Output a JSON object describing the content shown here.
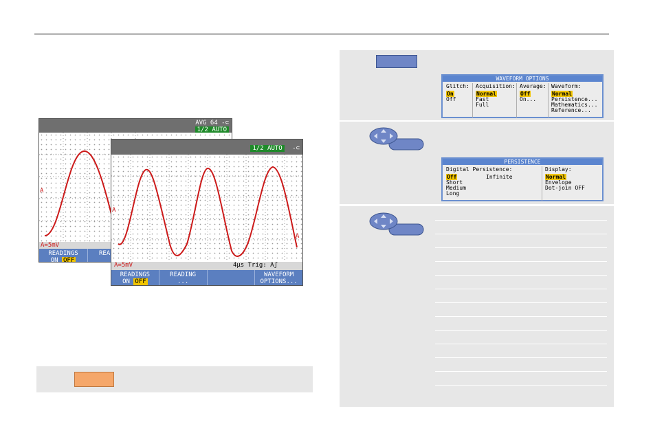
{
  "scope_back": {
    "status": "AVG 64",
    "auto_badge": "1/2 AUTO",
    "trace_label": "A",
    "scale_text": "A=5mV",
    "softkeys": [
      {
        "line1": "READINGS",
        "line2_prefix": "ON",
        "off": "OFF"
      },
      {
        "line1": "REA",
        "line2": ""
      }
    ]
  },
  "scope_front": {
    "auto_badge": "1/2 AUTO",
    "trace_label": "A",
    "end_label": "A",
    "scale_text": "A=5mV",
    "trig_text": "4µs Trig: Aʃ",
    "softkeys": [
      {
        "line1": "READINGS",
        "line2_prefix": "ON",
        "off": "OFF"
      },
      {
        "line1": "READING",
        "line2": "..."
      },
      {
        "line1": "",
        "line2": ""
      },
      {
        "line1": "WAVEFORM",
        "line2": "OPTIONS..."
      }
    ]
  },
  "waveform_options": {
    "title": "WAVEFORM OPTIONS",
    "glitch": {
      "header": "Glitch:",
      "selected": "On",
      "items": [
        "Off"
      ]
    },
    "acquisition": {
      "header": "Acquisition:",
      "selected": "Normal",
      "items": [
        "Fast",
        "Full"
      ]
    },
    "average": {
      "header": "Average:",
      "selected": "Off",
      "items": [
        "On..."
      ]
    },
    "waveform": {
      "header": "Waveform:",
      "selected": "Normal",
      "items": [
        "Persistence...",
        "Mathematics...",
        "Reference..."
      ]
    }
  },
  "persistence": {
    "title": "PERSISTENCE",
    "digital": {
      "header": "Digital Persistence:",
      "selected": "Off",
      "items": [
        "Short",
        "Medium",
        "Long"
      ],
      "infinite": "Infinite"
    },
    "display": {
      "header": "Display:",
      "selected": "Normal",
      "items": [
        "Envelope",
        "Dot-join OFF"
      ]
    }
  },
  "colors": {
    "trace": "#cc1a1a",
    "softkey": "#5b7fc0",
    "highlight": "#f0c400",
    "menu_title": "#5b85cf",
    "orange_key": "#f5a76a"
  }
}
